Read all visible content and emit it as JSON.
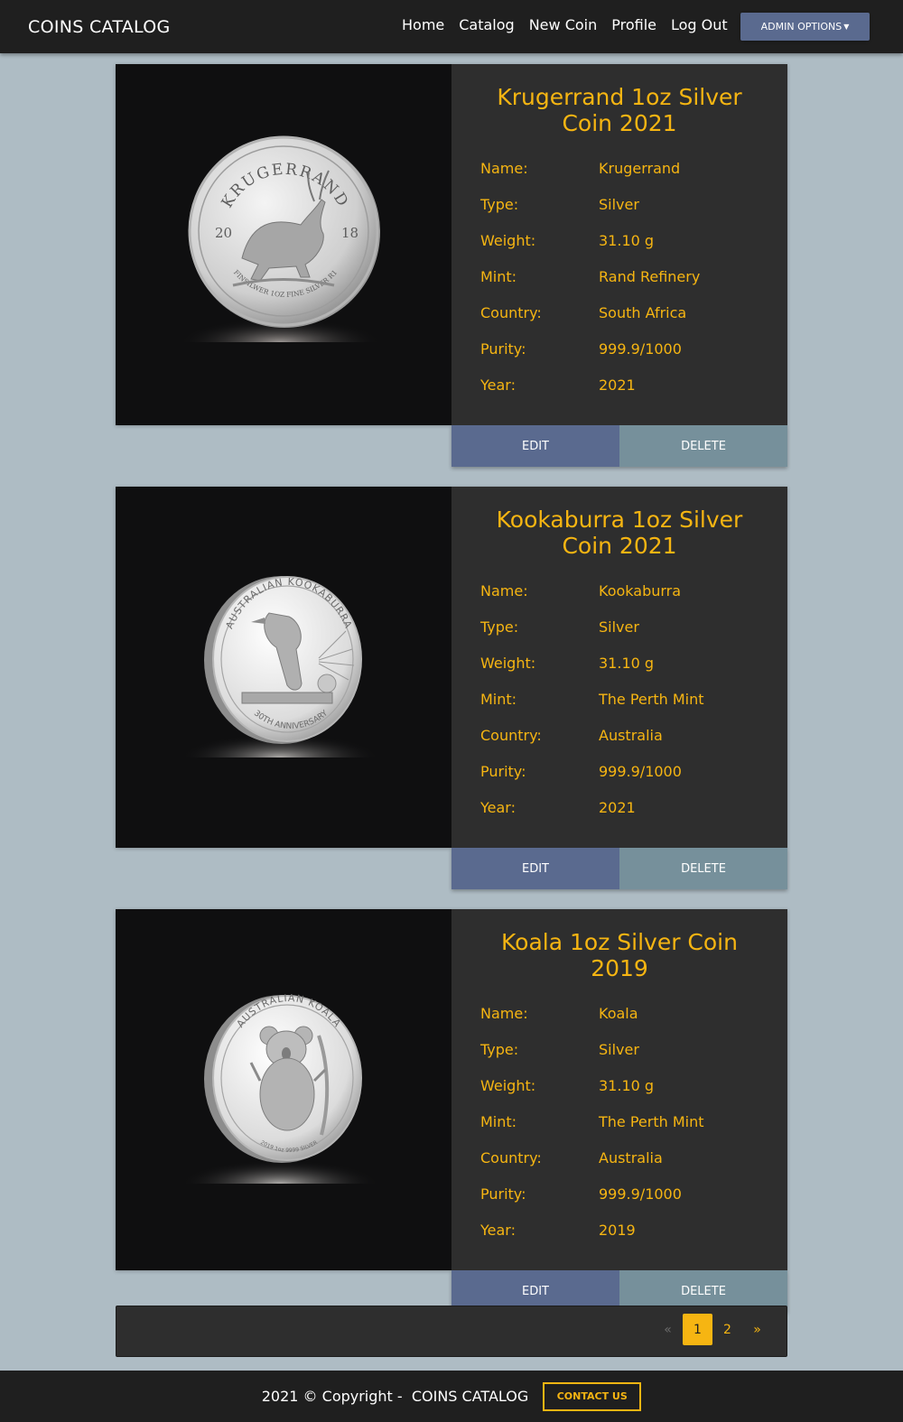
{
  "navbar": {
    "brand": "COINS CATALOG",
    "links": [
      "Home",
      "Catalog",
      "New Coin",
      "Profile",
      "Log Out"
    ],
    "admin_label": "ADMIN OPTIONS"
  },
  "labels": {
    "name": "Name:",
    "type": "Type:",
    "weight": "Weight:",
    "mint": "Mint:",
    "country": "Country:",
    "purity": "Purity:",
    "year": "Year:"
  },
  "coins": [
    {
      "title": "Krugerrand 1oz Silver Coin 2021",
      "name": "Krugerrand",
      "type": "Silver",
      "weight": "31.10 g",
      "mint": "Rand Refinery",
      "country": "South Africa",
      "purity": "999.9/1000",
      "year": "2021",
      "edit_label": "EDIT",
      "delete_label": "DELETE",
      "image_text": {
        "top": "KRUGERRAND",
        "left": "20",
        "right": "18",
        "bottom": "FINSILWER 1OZ FINE SILVER R1"
      }
    },
    {
      "title": "Kookaburra 1oz Silver Coin 2021",
      "name": "Kookaburra",
      "type": "Silver",
      "weight": "31.10 g",
      "mint": "The Perth Mint",
      "country": "Australia",
      "purity": "999.9/1000",
      "year": "2021",
      "edit_label": "EDIT",
      "delete_label": "DELETE",
      "image_text": {
        "top": "AUSTRALIAN KOOKABURRA",
        "bottom": "30TH ANNIVERSARY"
      }
    },
    {
      "title": "Koala 1oz Silver Coin 2019",
      "name": "Koala",
      "type": "Silver",
      "weight": "31.10 g",
      "mint": "The Perth Mint",
      "country": "Australia",
      "purity": "999.9/1000",
      "year": "2019",
      "edit_label": "EDIT",
      "delete_label": "DELETE",
      "image_text": {
        "top": "AUSTRALIAN KOALA",
        "bottom": "2019 1oz 9999 SILVER"
      }
    }
  ],
  "pagination": {
    "prev": "«",
    "pages": [
      "1",
      "2"
    ],
    "active": "1",
    "next": "»"
  },
  "footer": {
    "copyright": "2021 © Copyright -  COINS CATALOG",
    "contact_label": "CONTACT US"
  },
  "colors": {
    "accent": "#f6b512",
    "navbar": "#1f1f1f",
    "card": "#2e2e2e",
    "edit": "#5a6a8f",
    "delete": "#76909b",
    "page_bg": "#aebcc4"
  }
}
